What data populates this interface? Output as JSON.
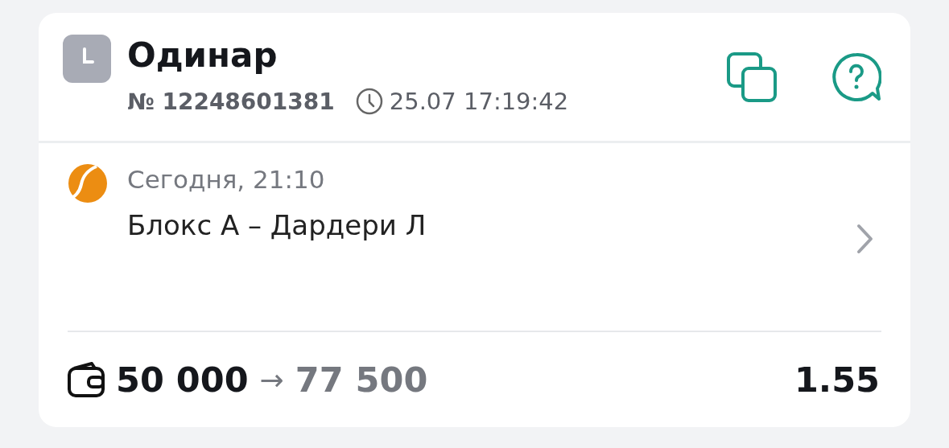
{
  "bet": {
    "type": "Одинар",
    "number": "№ 12248601381",
    "datetime": "25.07 17:19:42"
  },
  "event": {
    "time": "Сегодня, 21:10",
    "name": "Блокс А – Дардери Л"
  },
  "footer": {
    "stake": "50 000",
    "arrow": "→",
    "payout": "77 500",
    "odds": "1.55"
  }
}
